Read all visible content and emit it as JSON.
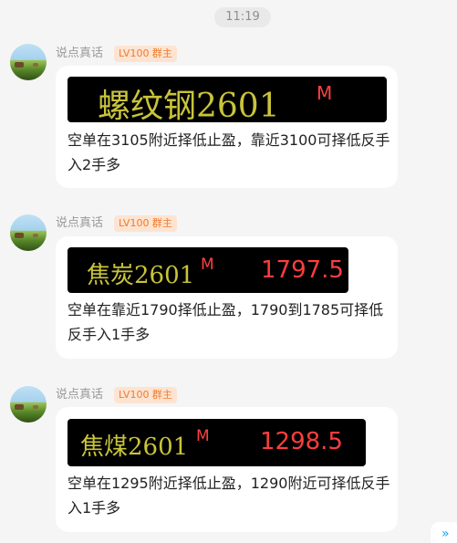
{
  "time": "11:19",
  "messages": [
    {
      "sender": "说点真话",
      "badge": "LV100 群主",
      "quote": {
        "symbol": "螺纹钢2601",
        "marker": "M",
        "price": ""
      },
      "text": "空单在3105附近择低止盈，靠近3100可择低反手入2手多"
    },
    {
      "sender": "说点真话",
      "badge": "LV100 群主",
      "quote": {
        "symbol": "焦炭2601",
        "marker": "M",
        "price": "1797.5"
      },
      "text": "空单在靠近1790择低止盈，1790到1785可择低反手入1手多"
    },
    {
      "sender": "说点真话",
      "badge": "LV100 群主",
      "quote": {
        "symbol": "焦煤2601",
        "marker": "M",
        "price": "1298.5"
      },
      "text": "空单在1295附近择低止盈，1290附近可择低反手入1手多"
    }
  ],
  "colors": {
    "background": "#f5f5f5",
    "bubble": "#ffffff",
    "badge_bg": "#fde4d2",
    "badge_text": "#f07b2a",
    "quote_symbol": "#c9c43a",
    "quote_price": "#ff3d3d"
  },
  "icons": {
    "corner": "double-chevron-icon"
  }
}
